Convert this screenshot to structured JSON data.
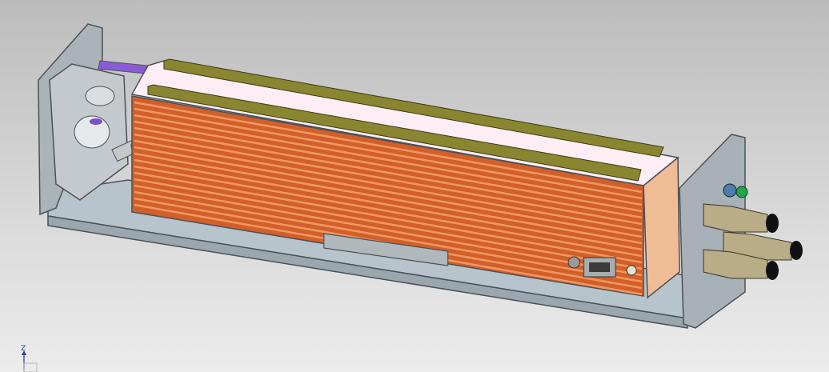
{
  "view": {
    "triad_axis_label": "Z"
  },
  "colors": {
    "background_top": "#bcbcbc",
    "background_bottom": "#ececec",
    "base_plate": "#b7c4cc",
    "housing": "#d25f2a",
    "fin": "#f09860",
    "rail": "#8a8530",
    "top_panel": "#ffeef5",
    "bracket": "#a7b1b7",
    "end_plate": "#f0bc96",
    "connector": "#b8ad86",
    "connector_tip": "#111111",
    "purple_strip": "#8a5bd6",
    "axis_blue": "#2a3fa0"
  }
}
